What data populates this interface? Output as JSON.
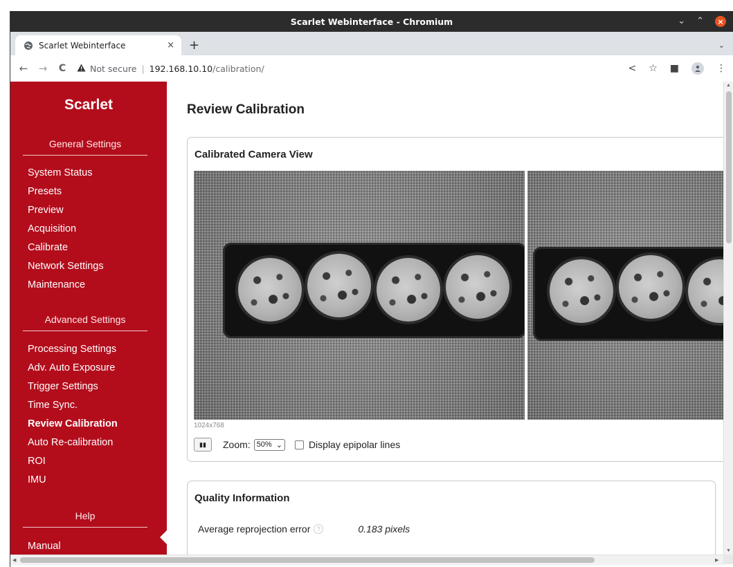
{
  "window": {
    "title": "Scarlet Webinterface - Chromium",
    "controls": {
      "minimize": "⌄",
      "maximize": "⌃",
      "close": "×"
    }
  },
  "browser": {
    "tab_title": "Scarlet Webinterface",
    "tab_close": "×",
    "new_tab": "+",
    "tab_menu": "⌄",
    "nav": {
      "back": "←",
      "forward": "→",
      "reload": "C"
    },
    "security_label": "Not secure",
    "separator": "|",
    "url_host": "192.168.10.10",
    "url_path": "/calibration/",
    "toolbar_icons": {
      "share": "<",
      "bookmark": "☆",
      "sidepanel": "■",
      "menu": "⋮"
    }
  },
  "sidebar": {
    "brand": "Scarlet",
    "sections": [
      {
        "heading": "General Settings",
        "items": [
          "System Status",
          "Presets",
          "Preview",
          "Acquisition",
          "Calibrate",
          "Network Settings",
          "Maintenance"
        ]
      },
      {
        "heading": "Advanced Settings",
        "items": [
          "Processing Settings",
          "Adv. Auto Exposure",
          "Trigger Settings",
          "Time Sync.",
          "Review Calibration",
          "Auto Re-calibration",
          "ROI",
          "IMU"
        ]
      },
      {
        "heading": "Help",
        "items": [
          "Manual"
        ]
      }
    ],
    "active_item": "Review Calibration"
  },
  "main": {
    "page_title": "Review Calibration",
    "camera_panel": {
      "title": "Calibrated Camera View",
      "resolution": "1024x768",
      "pause_symbol": "▮▮",
      "zoom_label": "Zoom:",
      "zoom_value": "50%",
      "zoom_chevron": "⌄",
      "epipolar_label": "Display epipolar lines",
      "epipolar_checked": false
    },
    "quality_panel": {
      "title": "Quality Information",
      "rows": [
        {
          "label": "Average reprojection error",
          "help": "?",
          "value": "0.183 pixels"
        }
      ]
    }
  },
  "colors": {
    "sidebar_bg": "#b30d1c",
    "titlebar_bg": "#2c2c2c",
    "close_button": "#e95420"
  }
}
